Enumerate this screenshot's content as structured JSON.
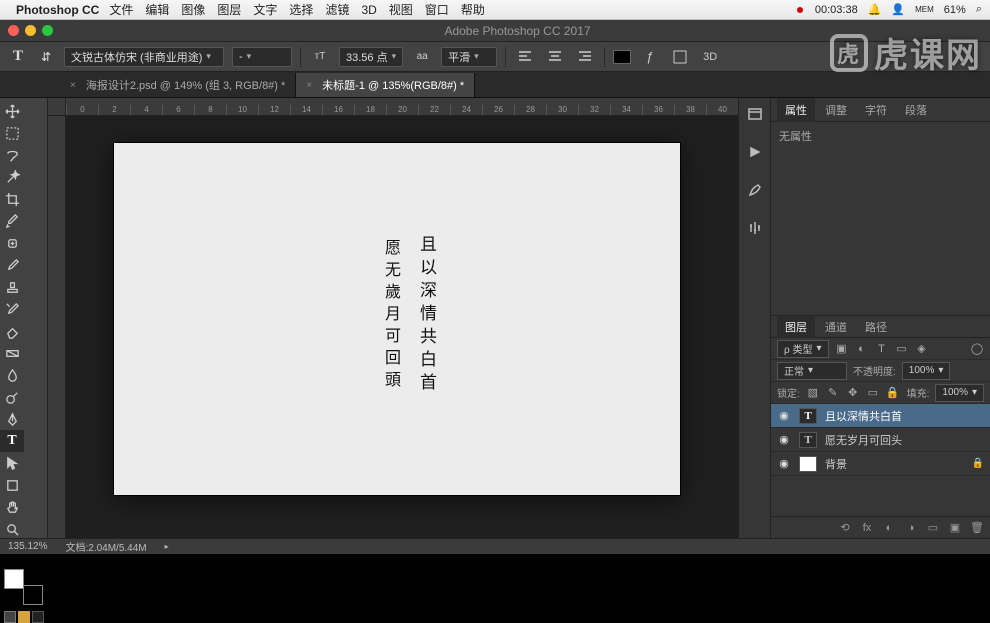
{
  "mac_menu": {
    "app": "Photoshop CC",
    "items": [
      "文件",
      "编辑",
      "图像",
      "图层",
      "文字",
      "选择",
      "滤镜",
      "3D",
      "视图",
      "窗口",
      "帮助"
    ],
    "clock": "00:03:38",
    "mem_label": "MEM",
    "mem_value": "61%"
  },
  "window": {
    "title": "Adobe Photoshop CC 2017"
  },
  "options": {
    "font_family": "文锐古体仿宋 (非商业用途)",
    "weight": "-",
    "size": "33.56 点",
    "aa_prefix": "aa",
    "aa_mode": "平滑",
    "three_d": "3D"
  },
  "doc_tabs": [
    {
      "label": "海报设计2.psd @ 149% (组 3, RGB/8#) *",
      "active": false
    },
    {
      "label": "未标题-1 @ 135%(RGB/8#) *",
      "active": true
    }
  ],
  "ruler_marks": [
    "0",
    "2",
    "4",
    "6",
    "8",
    "10",
    "12",
    "14",
    "16",
    "18",
    "20",
    "22",
    "24",
    "26",
    "28",
    "30",
    "32",
    "34",
    "36",
    "38",
    "40"
  ],
  "canvas_text": {
    "line1": "且以深情共白首",
    "line2": "愿无歲月可回頭"
  },
  "properties_panel": {
    "tabs": [
      "属性",
      "调整",
      "字符",
      "段落"
    ],
    "content": "无属性"
  },
  "layers_panel": {
    "tabs": [
      "图层",
      "通道",
      "路径"
    ],
    "filter": "ρ 类型",
    "blend": "正常",
    "opacity_label": "不透明度:",
    "opacity_value": "100%",
    "lock_label": "锁定:",
    "fill_label": "填充:",
    "fill_value": "100%",
    "layers": [
      {
        "name": "且以深情共白首",
        "type": "text",
        "visible": true,
        "selected": true
      },
      {
        "name": "愿无岁月可回头",
        "type": "text",
        "visible": true,
        "selected": false
      },
      {
        "name": "背景",
        "type": "bg",
        "visible": true,
        "selected": false,
        "locked": true
      }
    ]
  },
  "status": {
    "zoom": "135.12%",
    "doc": "文档:2.04M/5.44M"
  },
  "watermark": {
    "icon": "虎",
    "text": "虎课网"
  }
}
